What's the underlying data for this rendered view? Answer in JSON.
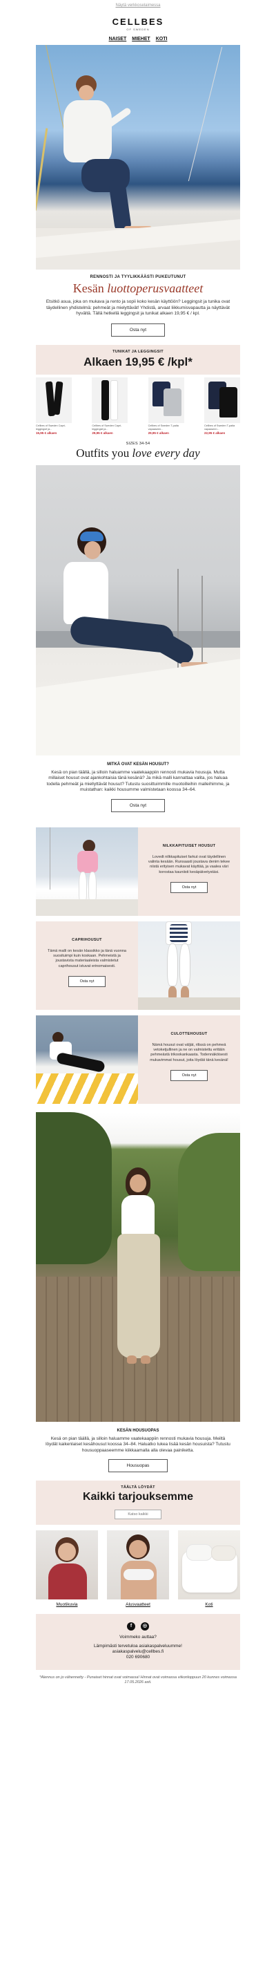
{
  "preheader": "Näytä verkkoselaimessa",
  "brand": {
    "name": "CELLBES",
    "sub": "OF SWEDEN"
  },
  "nav": [
    "NAISET",
    "MIEHET",
    "KOTI"
  ],
  "intro": {
    "kicker": "RENNOSTI JA TYYLIKKÄÄSTI PUKEUTUNUT",
    "title_plain": "Kesän ",
    "title_italic": "luottoperusvaatteet",
    "body": "Etsitkö asua, joka on mukava ja rento ja sopii koko kesän käyttöön? Leggingsit ja tunika ovat täydellinen yhdistelmä: pehmeät ja mielyttävät! Yhdistä, arvaat liikkumisvapautta ja näyttävät hyvältä. Tällä hetkellä leggingsit ja tunikat alkaen 19,95 € / kpl.",
    "button": "Osta nyt"
  },
  "offer": {
    "kicker": "TUNIKAT JA LEGGINGSIT",
    "title": "Alkaen 19,95 € /kpl*",
    "products": [
      {
        "name": "Cellbes of Sweden Capri-leggingsit ja...",
        "price": "15,95 € alkaen"
      },
      {
        "name": "Cellbes of Sweden Capri-leggingsit ja...",
        "price": "29,95 € alkaen"
      },
      {
        "name": "Cellbes of Sweden T-paita vapaaseen...",
        "price": "29,95 € alkaen"
      },
      {
        "name": "Cellbes of Sweden T-paita vapaaseen...",
        "price": "22,95 € alkaen"
      }
    ],
    "sizes": "SIZES 34-54",
    "subtitle_plain": "Outfits you ",
    "subtitle_italic": "love every day"
  },
  "trousers": {
    "kicker": "MITKÄ OVAT KESÄN HOUSUT?",
    "body": "Kesä on pian täällä, ja silloin haluamme vaatekaappiin rennosti mukavia housuja. Mutta millaiset housut ovat ajankohtaisia tänä kesänä? Ja mikä malli kannattaa valita, jos haluaa todella pehmeät ja miellyttävät housut? Tutustu suosittuimmille muotoilleihin malleihimme, ja muistathan: kaikki housumme valmistetaan koossa 34–64.",
    "button": "Osta nyt"
  },
  "blocks": [
    {
      "kicker": "NILKKAPITUISET HOUSUT",
      "body": "Lovedt nilkkapituiset farkut ovat täydellinen valinta kesään. Runsaasti joustava denim tekee niistä erityisen mukavat käyttää, ja vaalea väri korostaa kauniisti kesäpäivetystäsi.",
      "button": "Osta nyt"
    },
    {
      "kicker": "CAPRIHOUSUT",
      "body": "Tämä malli on kesän klassikko ja tänä vuonna suosituimpi kuin koskaan. Pehmeistä ja joustavista materiaaleista valmistetut caprihousut istuvat erinomaisesti.",
      "button": "Osta nyt"
    },
    {
      "kicker": "CULOTTEHOUSUT",
      "body": "Nämä housut ovat väljät, rilissä on pehmeä vetoketjullinen ja ne on valmistettu erittäin pehmeästä trikookankaasta. Todennäköisesti mukavimmat housut, joita löydät tänä kesänä!",
      "button": "Osta nyt"
    }
  ],
  "guide": {
    "kicker": "KESÄN HOUSUOPAS",
    "body": "Kesä on pian täällä, ja silloin haluamme vaatekaappiin rennosti mukavia housuja. Meiltä löydät kaikenlaiset kesähousut koossa 34–84. Haluatko lukea lisää kesän housuista? Tutustu housuoppaaseemme kiikkaamalla alla olevaa painiketta.",
    "button": "Housuopas"
  },
  "deals": {
    "kicker": "TÄÄLTÄ LÖYDÄT",
    "title": "Kaikki tarjouksemme",
    "button": "Katso kaikki"
  },
  "categories": [
    "Muotikuvia",
    "Alusvaatteet",
    "Koti"
  ],
  "footer": {
    "social": [
      "f",
      "◎"
    ],
    "greeting": "Voimmeko auttaa?",
    "line1": "Lämpimästi tervetuloa asiakaspalveluumme!",
    "email": "asiakaspalvelu@cellbes.fi",
    "phone": "020 690680"
  },
  "legal": "*Alennus on jo vähennetty - Punaiset hinnat ovat voimassa! Hinnat ovat voimassa viikonloppuun 20 kunnes voimassa 17.05.2026 asti."
}
